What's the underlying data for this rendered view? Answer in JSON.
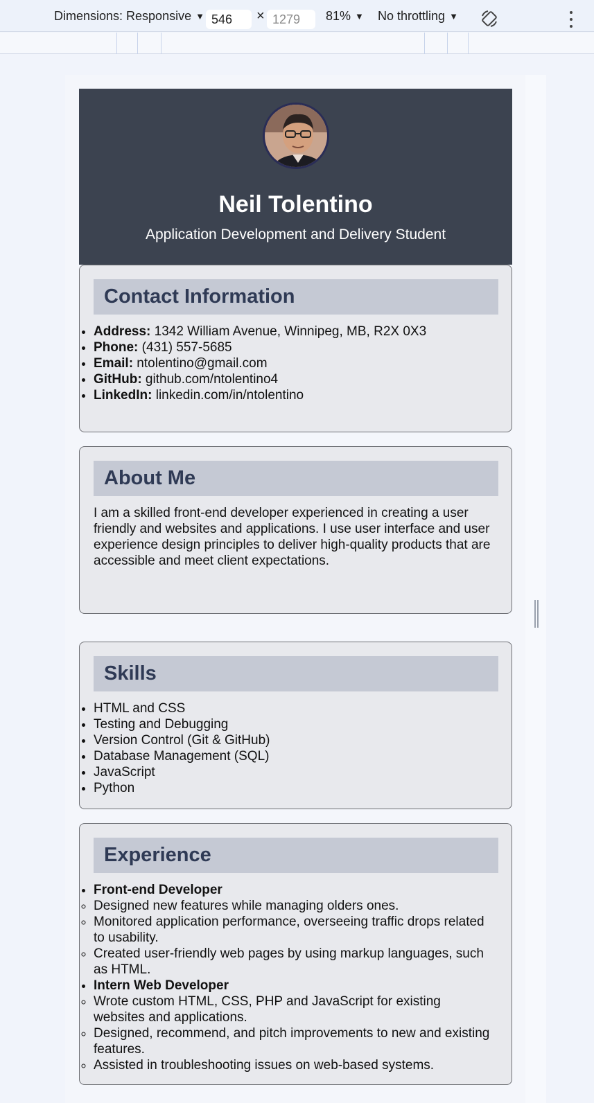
{
  "devtools": {
    "dimensions_label": "Dimensions: Responsive",
    "width_value": "546",
    "times": "×",
    "height_placeholder": "1279",
    "zoom": "81%",
    "throttling": "No throttling",
    "caret": "▼"
  },
  "resume": {
    "name": "Neil Tolentino",
    "subtitle": "Application Development and Delivery Student",
    "contact": {
      "title": "Contact Information",
      "items": [
        {
          "label": "Address:",
          "value": " 1342 William Avenue, Winnipeg, MB, R2X 0X3"
        },
        {
          "label": "Phone:",
          "value": " (431) 557-5685"
        },
        {
          "label": "Email:",
          "value": " ntolentino@gmail.com"
        },
        {
          "label": "GitHub:",
          "value": " github.com/ntolentino4"
        },
        {
          "label": "LinkedIn:",
          "value": " linkedin.com/in/ntolentino"
        }
      ]
    },
    "about": {
      "title": "About Me",
      "text": "I am a skilled front-end developer experienced in creating a user friendly and websites and applications. I use user interface and user experience design principles to deliver high-quality products that are accessible and meet client expectations."
    },
    "skills": {
      "title": "Skills",
      "items": [
        "HTML and CSS",
        "Testing and Debugging",
        "Version Control (Git & GitHub)",
        "Database Management (SQL)",
        "JavaScript",
        "Python"
      ]
    },
    "experience": {
      "title": "Experience",
      "roles": [
        {
          "role": "Front-end Developer",
          "tasks": [
            "Designed new features while managing olders ones.",
            "Monitored application performance, overseeing traffic drops related to usability.",
            "Created user-friendly web pages by using markup languages, such as HTML."
          ]
        },
        {
          "role": "Intern Web Developer",
          "tasks": [
            "Wrote custom HTML, CSS, PHP and JavaScript for existing websites and applications.",
            "Designed, recommend, and pitch improvements to new and existing features.",
            "Assisted in troubleshooting issues on web-based systems."
          ]
        }
      ]
    }
  }
}
